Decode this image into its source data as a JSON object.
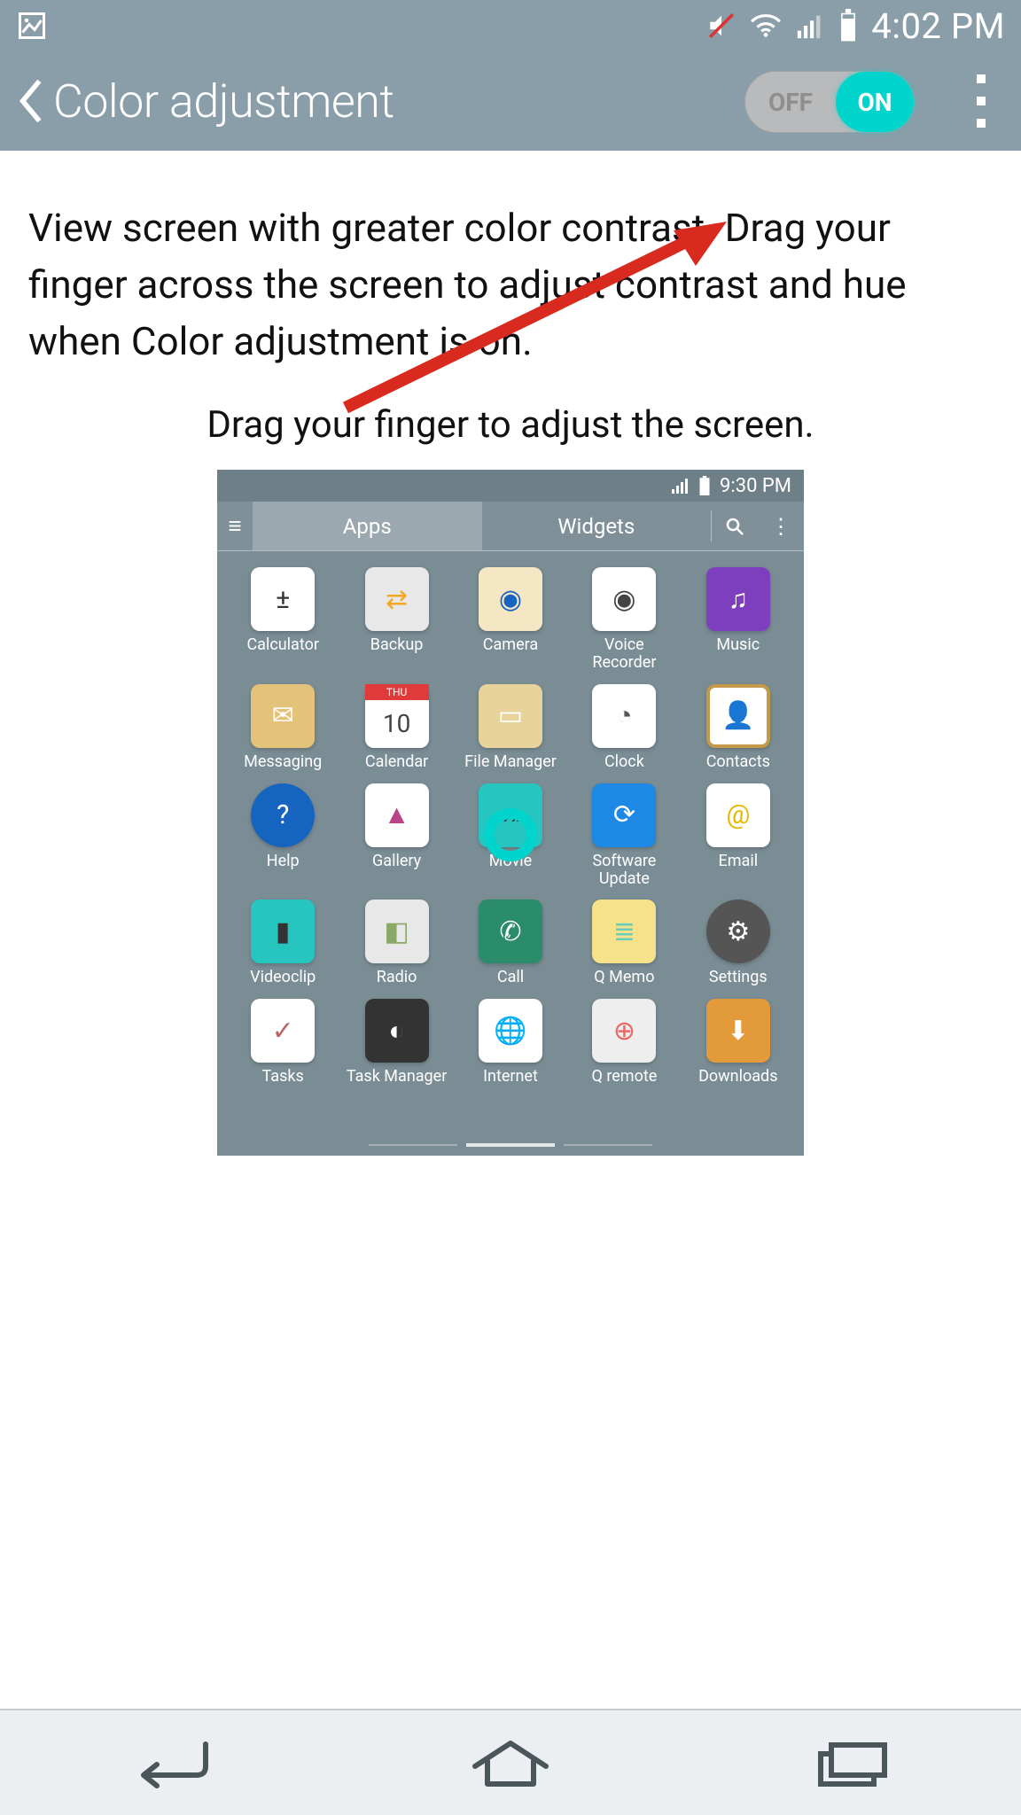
{
  "statusbar": {
    "time": "4:02 PM"
  },
  "titlebar": {
    "title": "Color adjustment",
    "toggle_off": "OFF",
    "toggle_on": "ON"
  },
  "body": {
    "description": "View screen with greater color contrast. Drag your finger across the screen to adjust contrast and hue when Color adjustment is on.",
    "drag_hint": "Drag your finger to adjust the screen."
  },
  "preview": {
    "time": "9:30 PM",
    "tab_apps": "Apps",
    "tab_widgets": "Widgets",
    "calendar_day": "THU",
    "calendar_date": "10",
    "apps": [
      {
        "label": "Calculator",
        "icon": "calc"
      },
      {
        "label": "Backup",
        "icon": "backup"
      },
      {
        "label": "Camera",
        "icon": "camera"
      },
      {
        "label": "Voice Recorder",
        "icon": "voice"
      },
      {
        "label": "Music",
        "icon": "music"
      },
      {
        "label": "Messaging",
        "icon": "msg"
      },
      {
        "label": "Calendar",
        "icon": "cal"
      },
      {
        "label": "File Manager",
        "icon": "file"
      },
      {
        "label": "Clock",
        "icon": "clock"
      },
      {
        "label": "Contacts",
        "icon": "contacts"
      },
      {
        "label": "Help",
        "icon": "help"
      },
      {
        "label": "Gallery",
        "icon": "gallery"
      },
      {
        "label": "Movie",
        "icon": "movie"
      },
      {
        "label": "Software Update",
        "icon": "sw"
      },
      {
        "label": "Email",
        "icon": "email"
      },
      {
        "label": "Videoclip",
        "icon": "video"
      },
      {
        "label": "Radio",
        "icon": "radio"
      },
      {
        "label": "Call",
        "icon": "call"
      },
      {
        "label": "Q Memo",
        "icon": "qmemo"
      },
      {
        "label": "Settings",
        "icon": "settings"
      },
      {
        "label": "Tasks",
        "icon": "tasks"
      },
      {
        "label": "Task Manager",
        "icon": "taskmgr"
      },
      {
        "label": "Internet",
        "icon": "internet"
      },
      {
        "label": "Q remote",
        "icon": "qremote"
      },
      {
        "label": "Downloads",
        "icon": "downloads"
      }
    ]
  }
}
